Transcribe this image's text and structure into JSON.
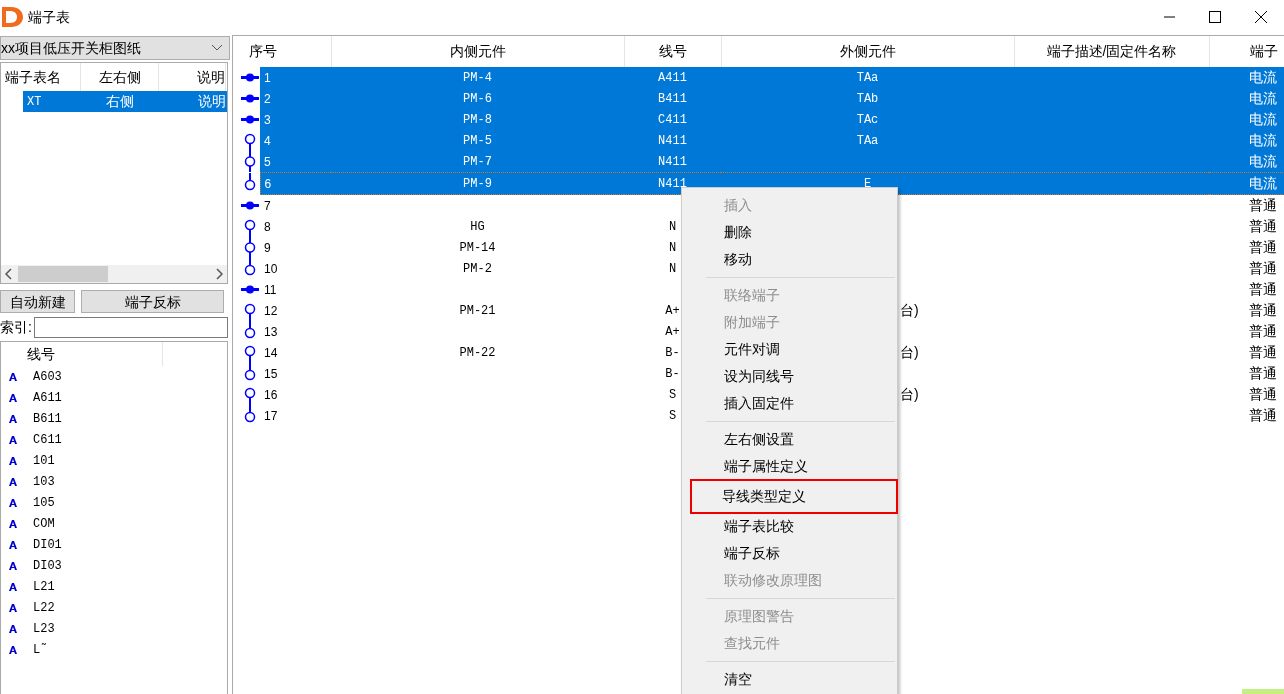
{
  "window": {
    "title": "端子表"
  },
  "left_panel": {
    "drawing_select": {
      "value": "xx项目低压开关柜图纸"
    },
    "tables_grid": {
      "columns": [
        "端子表名",
        "左右侧",
        "说明"
      ],
      "rows": [
        {
          "cells": [
            "XT",
            "右侧",
            "说明"
          ],
          "selected": true
        }
      ]
    },
    "buttons": [
      "自动新建",
      "端子反标"
    ],
    "index_field": {
      "label": "索引:"
    },
    "wire_list": {
      "column": "线号",
      "items": [
        {
          "label": "A603"
        },
        {
          "label": "A611"
        },
        {
          "label": "B611"
        },
        {
          "label": "C611"
        },
        {
          "label": "101"
        },
        {
          "label": "103"
        },
        {
          "label": "105"
        },
        {
          "label": "COM"
        },
        {
          "label": "DI01"
        },
        {
          "label": "DI03"
        },
        {
          "label": "L21"
        },
        {
          "label": "L22"
        },
        {
          "label": "L23"
        },
        {
          "label": "L˜"
        }
      ]
    }
  },
  "terminal_table": {
    "columns": [
      "序号",
      "内侧元件",
      "线号",
      "外侧元件",
      "端子描述/固定件名称",
      "端子"
    ],
    "rows": [
      {
        "kind": "single",
        "number": "1",
        "inner": "PM-4",
        "wire": "A411",
        "outer": "TAa",
        "type": "电流",
        "selected": true,
        "focused": false
      },
      {
        "kind": "single",
        "number": "2",
        "inner": "PM-6",
        "wire": "B411",
        "outer": "TAb",
        "type": "电流",
        "selected": true,
        "focused": false
      },
      {
        "kind": "single",
        "number": "3",
        "inner": "PM-8",
        "wire": "C411",
        "outer": "TAc",
        "type": "电流",
        "selected": true,
        "focused": false
      },
      {
        "kind": "first",
        "number": "4",
        "inner": "PM-5",
        "wire": "N411",
        "outer": "TAa",
        "type": "电流",
        "selected": true,
        "focused": false
      },
      {
        "kind": "middle",
        "number": "5",
        "inner": "PM-7",
        "wire": "N411",
        "type": "电流",
        "selected": true,
        "focused": false
      },
      {
        "kind": "last",
        "number": "6",
        "inner": "PM-9",
        "wire": "N411",
        "outer": "E",
        "type": "电流",
        "selected": true,
        "focused": true
      },
      {
        "kind": "single",
        "number": "7",
        "type": "普通",
        "selected": false,
        "focused": false
      },
      {
        "kind": "first",
        "number": "8",
        "inner": "HG",
        "wire": "N",
        "type": "普通",
        "selected": false,
        "focused": false
      },
      {
        "kind": "middle",
        "number": "9",
        "inner": "PM-14",
        "wire": "N",
        "type": "普通",
        "selected": false,
        "focused": false
      },
      {
        "kind": "last",
        "number": "10",
        "inner": "PM-2",
        "wire": "N",
        "type": "普通",
        "selected": false,
        "focused": false
      },
      {
        "kind": "single",
        "number": "11",
        "type": "普通",
        "selected": false,
        "focused": false
      },
      {
        "kind": "first",
        "number": "12",
        "inner": "PM-21",
        "wire": "A+",
        "outer_tail": "台)",
        "type": "普通",
        "selected": false,
        "focused": false
      },
      {
        "kind": "last",
        "number": "13",
        "wire": "A+",
        "type": "普通",
        "selected": false,
        "focused": false
      },
      {
        "kind": "first",
        "number": "14",
        "inner": "PM-22",
        "wire": "B-",
        "outer_tail": "台)",
        "type": "普通",
        "selected": false,
        "focused": false
      },
      {
        "kind": "last",
        "number": "15",
        "wire": "B-",
        "type": "普通",
        "selected": false,
        "focused": false
      },
      {
        "kind": "first",
        "number": "16",
        "wire": "S",
        "outer_tail": "台)",
        "type": "普通",
        "selected": false,
        "focused": false
      },
      {
        "kind": "last",
        "number": "17",
        "wire": "S",
        "type": "普通",
        "selected": false,
        "focused": false
      }
    ]
  },
  "context_menu": {
    "items": [
      {
        "kind": "item",
        "label": "插入",
        "disabled": true,
        "outlined": false
      },
      {
        "kind": "item",
        "label": "删除",
        "disabled": false,
        "outlined": false
      },
      {
        "kind": "item",
        "label": "移动",
        "disabled": false,
        "outlined": false
      },
      {
        "kind": "separator"
      },
      {
        "kind": "item",
        "label": "联络端子",
        "disabled": true,
        "outlined": false
      },
      {
        "kind": "item",
        "label": "附加端子",
        "disabled": true,
        "outlined": false
      },
      {
        "kind": "item",
        "label": "元件对调",
        "disabled": false,
        "outlined": false
      },
      {
        "kind": "item",
        "label": "设为同线号",
        "disabled": false,
        "outlined": false
      },
      {
        "kind": "item",
        "label": "插入固定件",
        "disabled": false,
        "outlined": false
      },
      {
        "kind": "separator"
      },
      {
        "kind": "item",
        "label": "左右侧设置",
        "disabled": false,
        "outlined": false
      },
      {
        "kind": "item",
        "label": "端子属性定义",
        "disabled": false,
        "outlined": false
      },
      {
        "kind": "item",
        "label": "导线类型定义",
        "disabled": false,
        "outlined": true
      },
      {
        "kind": "item",
        "label": "端子表比较",
        "disabled": false,
        "outlined": false
      },
      {
        "kind": "item",
        "label": "端子反标",
        "disabled": false,
        "outlined": false
      },
      {
        "kind": "item",
        "label": "联动修改原理图",
        "disabled": true,
        "outlined": false
      },
      {
        "kind": "separator"
      },
      {
        "kind": "item",
        "label": "原理图警告",
        "disabled": true,
        "outlined": false
      },
      {
        "kind": "item",
        "label": "查找元件",
        "disabled": true,
        "outlined": false
      },
      {
        "kind": "separator"
      },
      {
        "kind": "item",
        "label": "清空",
        "disabled": false,
        "outlined": false
      }
    ]
  }
}
